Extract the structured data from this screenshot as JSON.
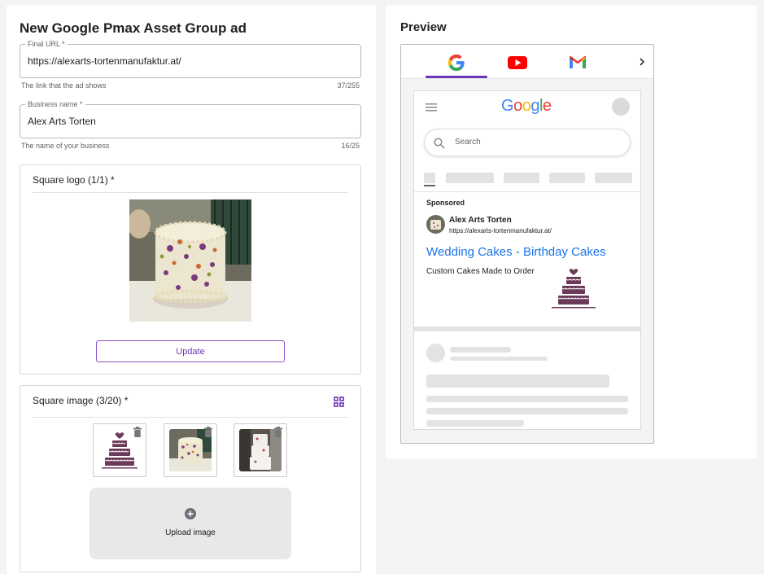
{
  "form": {
    "title": "New Google Pmax Asset Group ad",
    "final_url": {
      "label": "Final URL *",
      "value": "https://alexarts-tortenmanufaktur.at/",
      "helper": "The link that the ad shows",
      "count": "37/255"
    },
    "business_name": {
      "label": "Business name *",
      "value": "Alex Arts Torten",
      "helper": "The name of your business",
      "count": "16/25"
    },
    "square_logo": {
      "title": "Square logo (1/1) *",
      "update_label": "Update"
    },
    "square_image": {
      "title": "Square image (3/20) *",
      "upload_label": "Upload image"
    }
  },
  "preview": {
    "title": "Preview",
    "tabs": [
      {
        "name": "google",
        "icon": "google-g-icon",
        "active": true
      },
      {
        "name": "youtube",
        "icon": "youtube-icon",
        "active": false
      },
      {
        "name": "gmail",
        "icon": "gmail-icon",
        "active": false
      }
    ],
    "google_logo": "Google",
    "search_placeholder": "Search",
    "ad": {
      "sponsored": "Sponsored",
      "business_name": "Alex Arts Torten",
      "url": "https://alexarts-tortenmanufaktur.at/",
      "headline": "Wedding Cakes - Birthday Cakes",
      "description": "Custom Cakes Made to Order"
    }
  },
  "colors": {
    "accent_purple": "#6a35b5",
    "link_blue": "#1a73e8",
    "cake_plum": "#6b3a5a"
  }
}
